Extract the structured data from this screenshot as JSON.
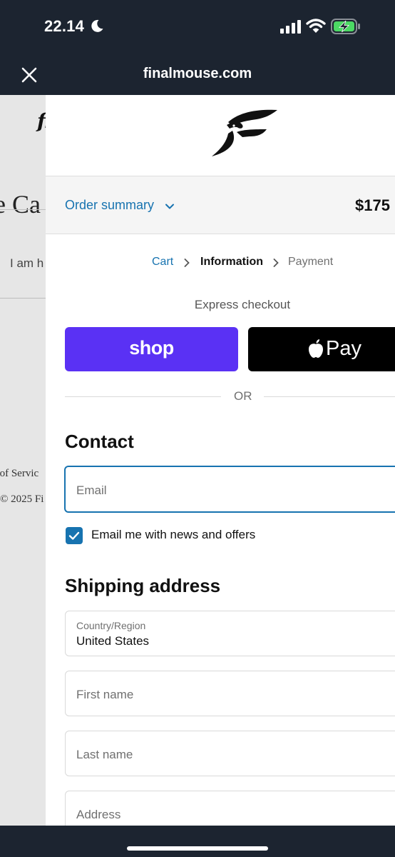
{
  "status_bar": {
    "time": "22.14",
    "icons": [
      "moon-icon",
      "signal-icon",
      "wifi-icon",
      "battery-charging-icon"
    ]
  },
  "browser": {
    "host": "finalmouse.com",
    "close_icon": "close-icon"
  },
  "background_page": {
    "logo_fragment": "fi",
    "heading_fragment": "e Ca",
    "text_fragment": "I am h",
    "terms_fragment": "s of Servic",
    "copyright_fragment": "© 2025 Fi"
  },
  "checkout": {
    "brand_icon": "finalmouse-logo-icon",
    "order_summary": {
      "label": "Order summary",
      "total": "$175"
    },
    "breadcrumb": {
      "cart": "Cart",
      "information": "Information",
      "payment": "Payment"
    },
    "express": {
      "heading": "Express checkout",
      "shop_label": "shop",
      "apple_pay_label": "Pay"
    },
    "divider_label": "OR",
    "contact": {
      "heading": "Contact",
      "email_placeholder": "Email",
      "newsletter_label": "Email me with news and offers",
      "newsletter_checked": true
    },
    "shipping": {
      "heading": "Shipping address",
      "country_label": "Country/Region",
      "country_value": "United States",
      "first_name_placeholder": "First name",
      "last_name_placeholder": "Last name",
      "address_placeholder": "Address"
    }
  },
  "colors": {
    "accent": "#1773b0",
    "shop_pay": "#5a31f4",
    "chrome": "#1c2430"
  }
}
